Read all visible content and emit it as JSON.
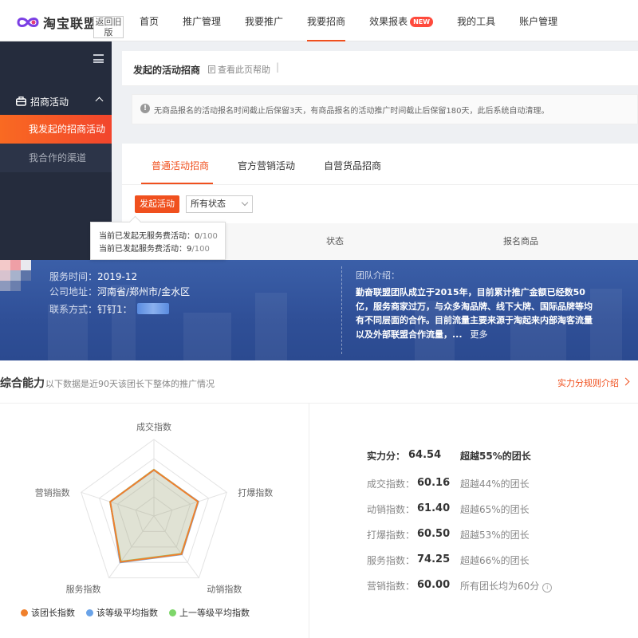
{
  "header": {
    "logo_text": "淘宝联盟",
    "back_old": "返回旧版",
    "nav": [
      {
        "label": "首页"
      },
      {
        "label": "推广管理"
      },
      {
        "label": "我要推广"
      },
      {
        "label": "我要招商"
      },
      {
        "label": "效果报表",
        "badge": "NEW"
      },
      {
        "label": "我的工具"
      },
      {
        "label": "账户管理"
      }
    ],
    "active_nav": "我要招商"
  },
  "sidebar": {
    "group_label": "招商活动",
    "items": [
      {
        "label": "我发起的招商活动"
      },
      {
        "label": "我合作的渠道"
      }
    ]
  },
  "page": {
    "title": "发起的活动招商",
    "help_link": "查看此页帮助",
    "help_sep": "|",
    "notice": "无商品报名的活动报名时间截止后保留3天，有商品报名的活动推广时间截止后保留180天，此后系统自动清理。",
    "tabs": [
      {
        "label": "普通活动招商"
      },
      {
        "label": "官方营销活动"
      },
      {
        "label": "自营货品招商"
      }
    ],
    "launch_button": "发起活动",
    "status_select": "所有状态",
    "columns": [
      "状态",
      "报名商品"
    ],
    "tooltip": {
      "line1_label": "当前已发起无服务费活动：",
      "line1_value": "0",
      "line1_total": "/100",
      "line2_label": "当前已发起服务费活动：",
      "line2_value": "9",
      "line2_total": "/100"
    }
  },
  "team": {
    "service_time_label": "服务时间：",
    "service_time": "2019-12",
    "address_label": "公司地址：",
    "address": "河南省/郑州市/金水区",
    "contact_label": "联系方式：",
    "contact": "钉钉1：",
    "intro_label": "团队介绍：",
    "intro": "勤奋联盟团队成立于2015年，目前累计推广金额已经数50亿，服务商家过万，与众多淘品牌、线下大牌、国际品牌等均有不同层面的合作。目前流量主要来源于淘起来内部淘客流量以及外部联盟合作流量，...",
    "more": "更多"
  },
  "ability": {
    "title": "综合能力",
    "subtitle": "以下数据是近90天该团长下整体的推广情况",
    "rule_link": "实力分规则介绍",
    "total_label": "实力分：",
    "total_value": "64.54",
    "total_compare": "超越55%的团长",
    "scores": [
      {
        "label": "成交指数：",
        "value": "60.16",
        "compare": "超越44%的团长"
      },
      {
        "label": "动销指数：",
        "value": "61.40",
        "compare": "超越65%的团长"
      },
      {
        "label": "打爆指数：",
        "value": "60.50",
        "compare": "超越53%的团长"
      },
      {
        "label": "服务指数：",
        "value": "74.25",
        "compare": "超越66%的团长"
      },
      {
        "label": "营销指数：",
        "value": "60.00",
        "compare": "所有团长均为60分"
      }
    ],
    "radar": {
      "axes": [
        "成交指数",
        "打爆指数",
        "动销指数",
        "服务指数",
        "营销指数"
      ],
      "series": [
        {
          "name": "该团长指数",
          "color": "#f0802c",
          "values": [
            60.16,
            60.5,
            61.4,
            74.25,
            60.0
          ]
        },
        {
          "name": "该等级平均指数",
          "color": "#6aa3e8",
          "values": [
            60.0,
            61.0,
            62.0,
            75.0,
            60.0
          ]
        },
        {
          "name": "上一等级平均指数",
          "color": "#7ed66a",
          "values": [
            60.5,
            60.8,
            61.0,
            73.5,
            60.2
          ]
        }
      ],
      "max": 100
    }
  }
}
